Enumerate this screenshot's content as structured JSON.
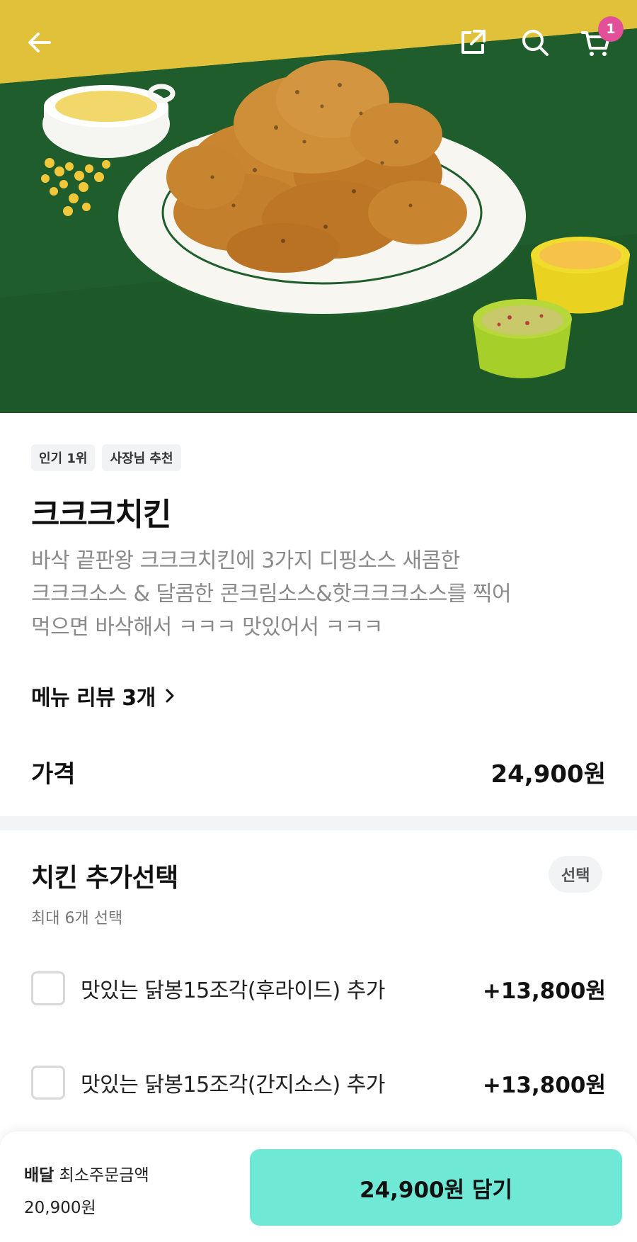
{
  "header": {
    "cart_count": "1",
    "icons": [
      "back-arrow-icon",
      "share-icon",
      "search-icon",
      "cart-icon"
    ]
  },
  "product": {
    "tags": [
      "인기 1위",
      "사장님 추천"
    ],
    "name": "크크크치킨",
    "description_lines": [
      "바삭 끝판왕 크크크치킨에 3가지 디핑소스 새콤한",
      "크크크소스 & 달콤한 콘크림소스&핫크크크소스를 찍어",
      "먹으면 바삭해서 ㅋㅋㅋ 맛있어서 ㅋㅋㅋ"
    ],
    "review_link": "메뉴 리뷰 3개",
    "price_label": "가격",
    "price_value": "24,900원"
  },
  "options": {
    "title": "치킨 추가선택",
    "badge": "선택",
    "subtitle": "최대 6개 선택",
    "items": [
      {
        "name": "맛있는 닭봉15조각(후라이드) 추가",
        "price": "+13,800원",
        "checked": false
      },
      {
        "name": "맛있는 닭봉15조각(간지소스) 추가",
        "price": "+13,800원",
        "checked": false
      }
    ]
  },
  "bottom_bar": {
    "delivery_label": "배달",
    "min_order_label": "최소주문금액",
    "min_order_value": "20,900원",
    "add_button": "24,900원 담기"
  },
  "colors": {
    "hero_yellow": "#e2c13a",
    "hero_green": "#1f5e2c",
    "cart_badge": "#e44f9a",
    "add_button": "#6fe8d6",
    "divider": "#f3f4f6"
  }
}
